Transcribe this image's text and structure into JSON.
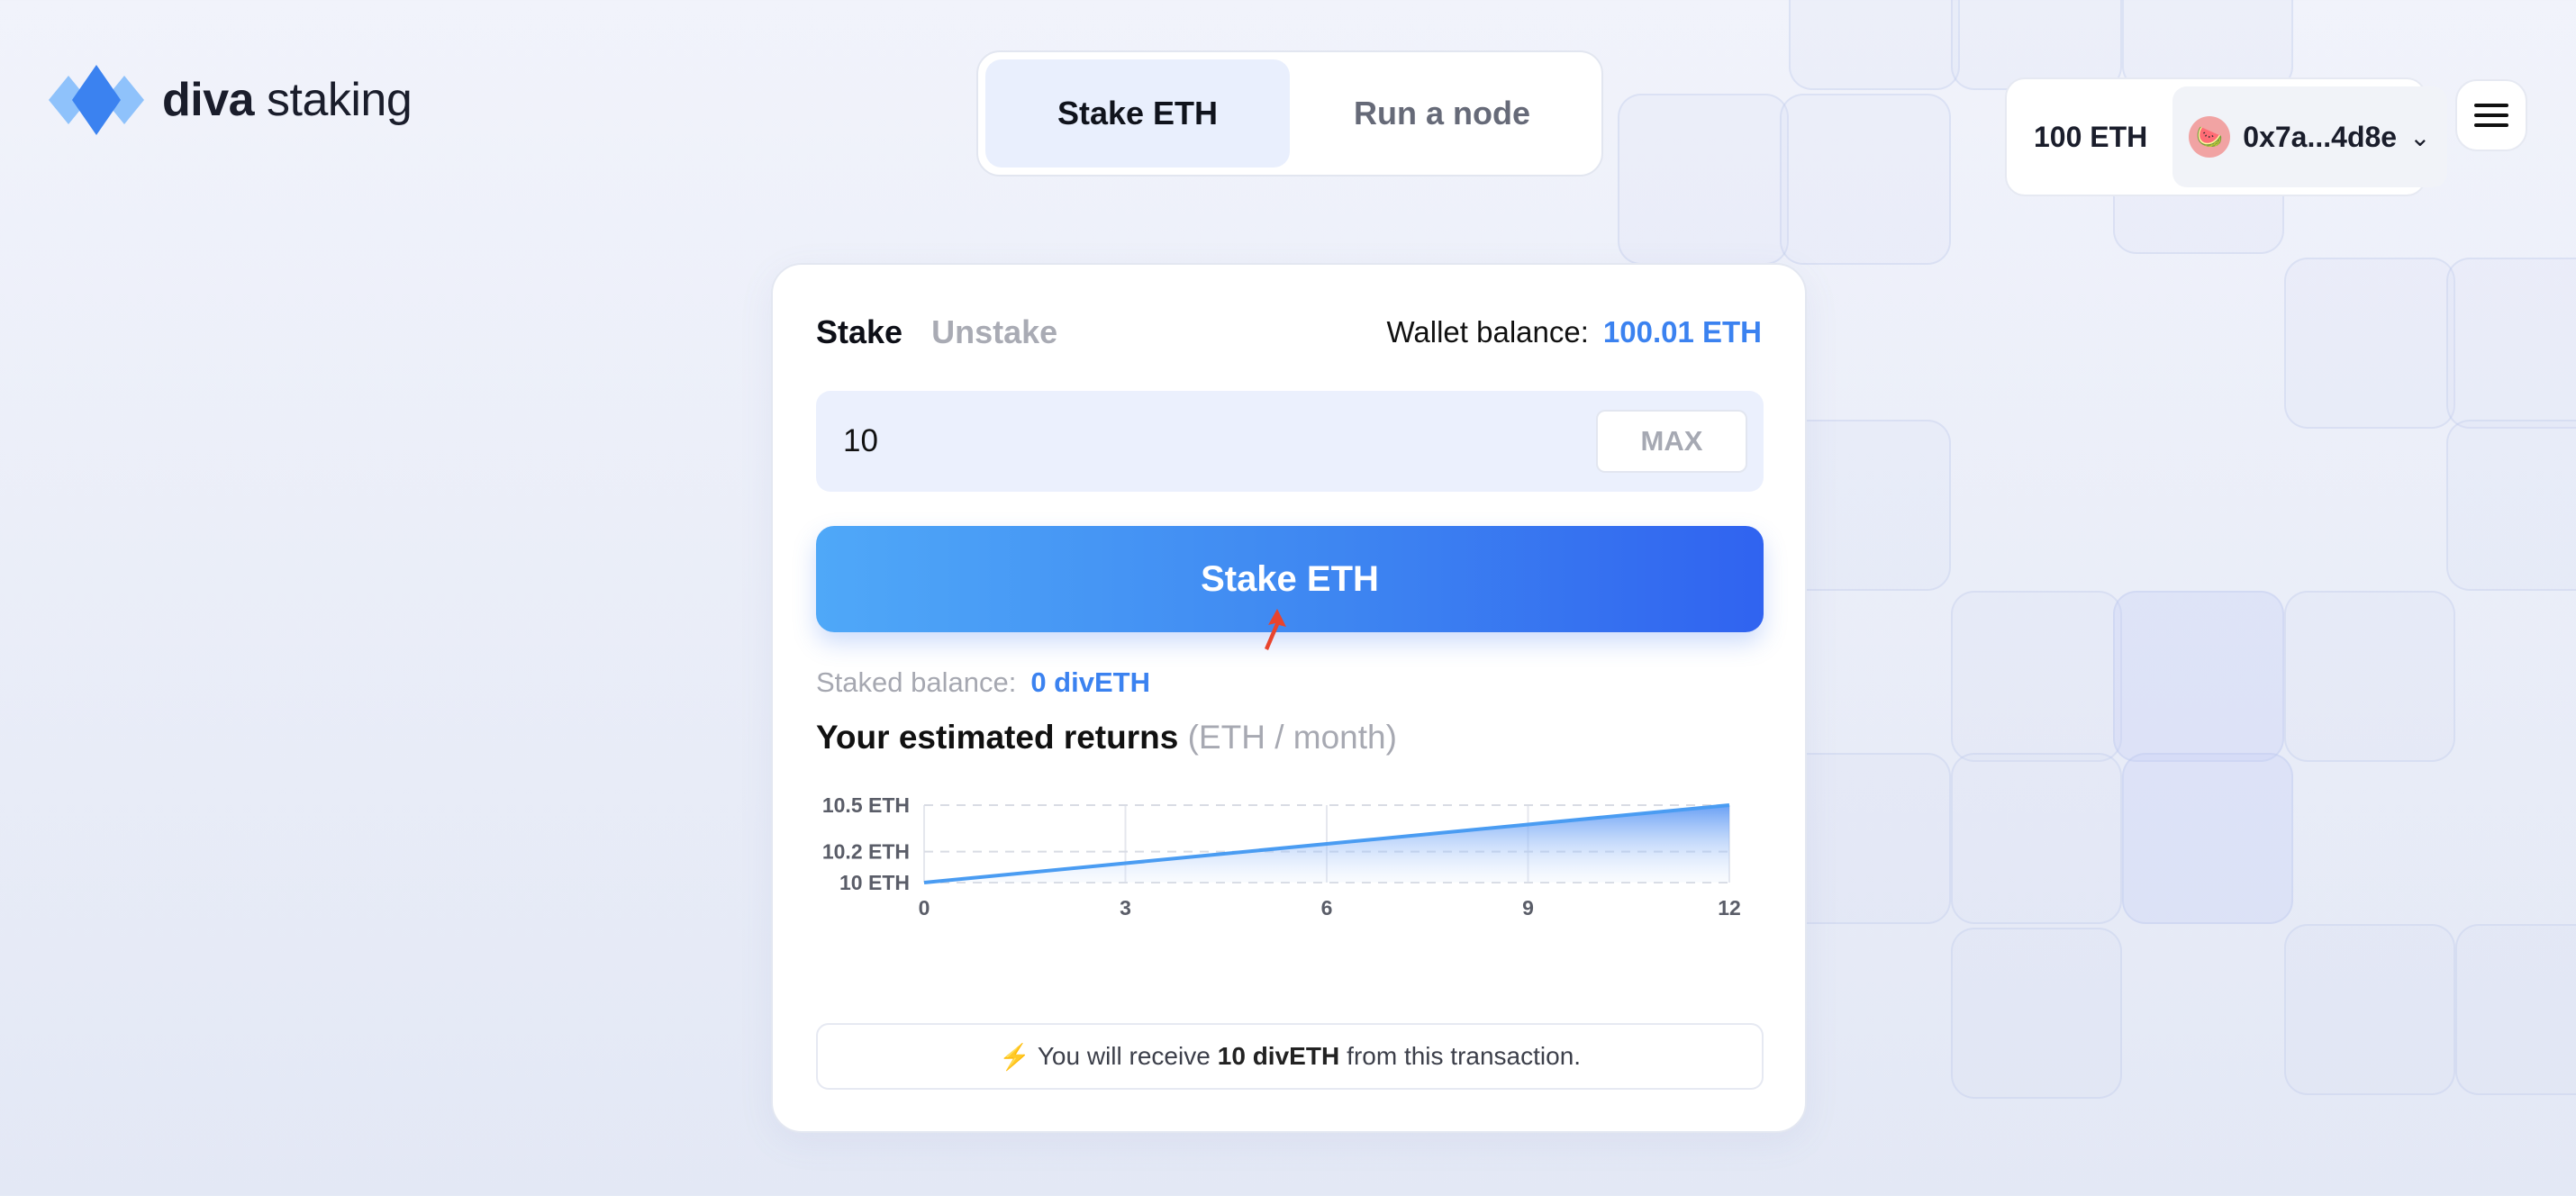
{
  "brand": {
    "name_bold": "diva",
    "name_regular": "staking"
  },
  "top_tabs": [
    {
      "label": "Stake ETH",
      "active": true
    },
    {
      "label": "Run a node",
      "active": false
    }
  ],
  "wallet": {
    "eth_balance": "100 ETH",
    "address": "0x7a...4d8e",
    "avatar_icon": "watermelon-icon"
  },
  "card": {
    "tabs": [
      {
        "label": "Stake",
        "active": true
      },
      {
        "label": "Unstake",
        "active": false
      }
    ],
    "wallet_balance_label": "Wallet balance:",
    "wallet_balance_value": "100.01 ETH",
    "amount_value": "10",
    "max_label": "MAX",
    "stake_button_label": "Stake ETH",
    "staked_balance_label": "Staked balance:",
    "staked_balance_value": "0 divETH",
    "returns_title": "Your estimated returns",
    "returns_unit": "(ETH / month)",
    "notice_pre": "You will receive",
    "notice_bold": "10 divETH",
    "notice_post": "from this transaction."
  },
  "colors": {
    "accent": "#3b82f0",
    "button_start": "#4fa8f8",
    "button_end": "#3063f0"
  },
  "chart_data": {
    "type": "area",
    "x": [
      0,
      3,
      6,
      9,
      12
    ],
    "y": [
      10,
      10.125,
      10.25,
      10.375,
      10.5
    ],
    "x_ticks": [
      "0",
      "3",
      "6",
      "9",
      "12"
    ],
    "y_ticks": [
      {
        "value": 10,
        "label": "10 ETH"
      },
      {
        "value": 10.2,
        "label": "10.2 ETH"
      },
      {
        "value": 10.5,
        "label": "10.5 ETH"
      }
    ],
    "xlim": [
      0,
      12
    ],
    "ylim": [
      10,
      10.5
    ],
    "grid": true
  }
}
